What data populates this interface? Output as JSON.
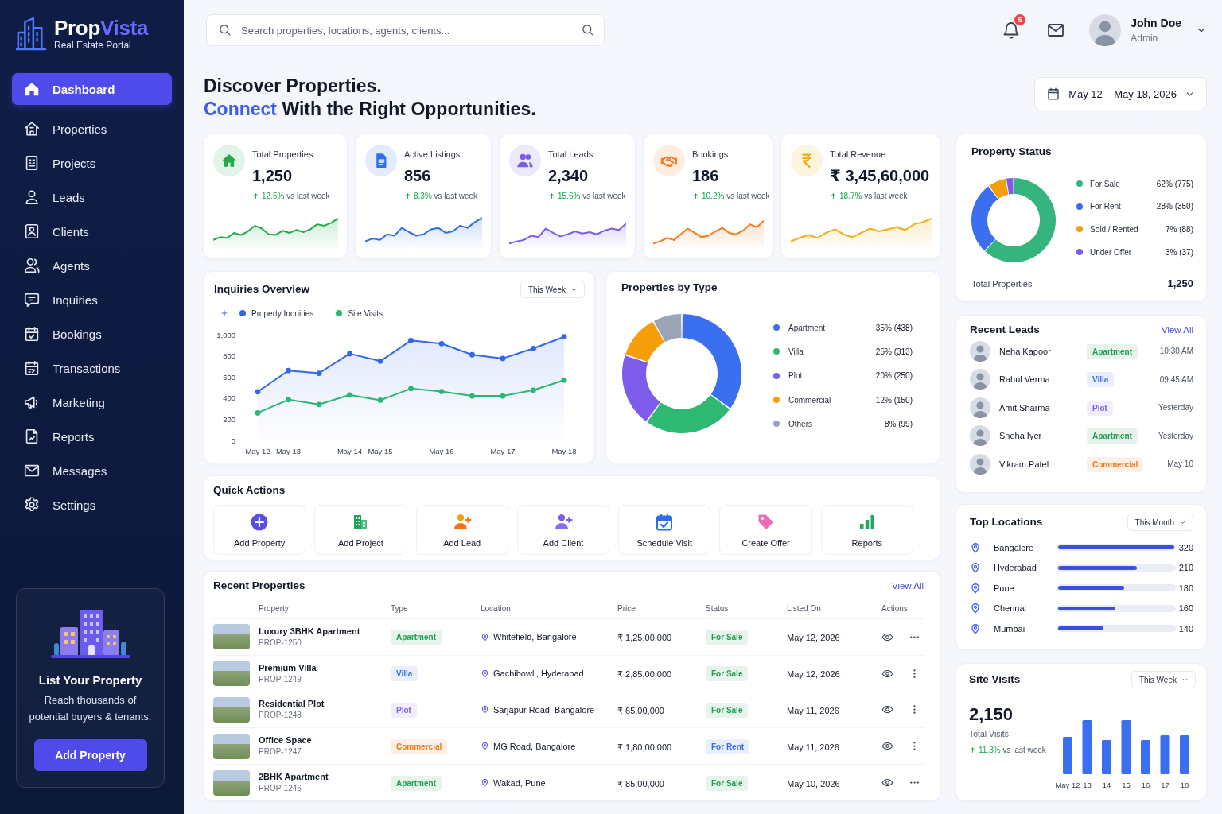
{
  "sidebar": {
    "brand": {
      "name": "Prop",
      "name_accent": "Vista",
      "tagline": "Real Estate Portal"
    },
    "nav": [
      {
        "label": "Dashboard",
        "selected": true
      },
      {
        "label": "Properties",
        "selected": false
      },
      {
        "label": "Projects",
        "selected": false
      },
      {
        "label": "Leads",
        "selected": false
      },
      {
        "label": "Clients",
        "selected": false
      },
      {
        "label": "Agents",
        "selected": false
      },
      {
        "label": "Inquiries",
        "selected": false
      },
      {
        "label": "Bookings",
        "selected": false
      },
      {
        "label": "Transactions",
        "selected": false
      },
      {
        "label": "Marketing",
        "selected": false
      },
      {
        "label": "Reports",
        "selected": false
      },
      {
        "label": "Messages",
        "selected": false
      },
      {
        "label": "Settings",
        "selected": false
      }
    ],
    "promo": {
      "title": "List Your Property",
      "text": "Reach thousands of potential buyers & tenants.",
      "button": "Add Property"
    }
  },
  "header": {
    "search": {
      "placeholder": "Search properties, locations, agents, clients..."
    },
    "notifications": {
      "count": "5"
    },
    "user": {
      "name": "John Doe",
      "role": "Admin"
    }
  },
  "intro": {
    "title": "Discover Properties.",
    "highlight": "Connect",
    "subtitle": "With the Right Opportunities."
  },
  "date_range": {
    "label": "May 12 – May 18, 2026"
  },
  "stats": [
    {
      "label": "Total Properties",
      "value": "1,250",
      "change": "12.5%",
      "change_note": "vs last week",
      "color": "#23a94b"
    },
    {
      "label": "Active Listings",
      "value": "856",
      "change": "8.3%",
      "change_note": "vs last week",
      "color": "#2f6fe6"
    },
    {
      "label": "Total Leads",
      "value": "2,340",
      "change": "15.6%",
      "change_note": "vs last week",
      "color": "#7b5ce8"
    },
    {
      "label": "Bookings",
      "value": "186",
      "change": "10.2%",
      "change_note": "vs last week",
      "color": "#f47a1f"
    },
    {
      "label": "Total Revenue",
      "value": "₹ 3,45,60,000",
      "change": "18.7%",
      "change_note": "vs last week",
      "color": "#f2ad17"
    }
  ],
  "inquiries": {
    "title": "Inquiries Overview",
    "period": "This Week",
    "chart_data": {
      "type": "line",
      "legend": "top",
      "categories": [
        "May 12",
        "May 13",
        null,
        "May 14",
        "May 15",
        null,
        "May 16",
        null,
        "May 17",
        null,
        "May 18"
      ],
      "ylim": [
        0,
        1000
      ],
      "yticks": [
        0,
        200,
        400,
        600,
        800,
        {
          "value": 1000,
          "label": "1,000"
        }
      ],
      "series": [
        {
          "name": "Property Inquiries",
          "type": "area",
          "marker": "circle",
          "color": "#3366ee",
          "values": [
            460,
            660,
            635,
            820,
            750,
            945,
            915,
            810,
            775,
            870,
            980
          ]
        },
        {
          "name": "Site Visits",
          "type": "line",
          "marker": "circle",
          "color": "#2bb673",
          "values": [
            260,
            385,
            340,
            430,
            380,
            490,
            462,
            420,
            420,
            475,
            570
          ]
        }
      ]
    }
  },
  "property_types": {
    "title": "Properties by Type",
    "chart_data": {
      "type": "donut",
      "legend": "right",
      "categories": [
        "Apartment",
        "Villa",
        "Plot",
        "Commercial",
        "Others"
      ],
      "values": [
        438,
        313,
        250,
        150,
        99
      ],
      "value_labels": [
        "35% (438)",
        "25% (313)",
        "20% (250)",
        "12% (150)",
        "8% (99)"
      ],
      "colors": [
        "#3a6ff0",
        "#2eb872",
        "#7c5ce8",
        "#f59e0b",
        "#9aa5b8"
      ]
    }
  },
  "quick_actions": {
    "title": "Quick Actions",
    "items": [
      "Add Property",
      "Add Project",
      "Add Lead",
      "Add Client",
      "Schedule Visit",
      "Create Offer",
      "Reports"
    ]
  },
  "recent_properties": {
    "title": "Recent Properties",
    "link": "View All",
    "columns": [
      "Property",
      "Type",
      "Location",
      "Price",
      "Status",
      "Listed On",
      "Actions"
    ],
    "rows": [
      {
        "name": "Luxury 3BHK Apartment",
        "id": "PROP-1250",
        "type": {
          "label": "Apartment",
          "color": "#1e9e52"
        },
        "location": "Whitefield, Bangalore",
        "price": "₹ 1,25,00,000",
        "status": {
          "label": "For Sale",
          "color": "#1e9e52"
        },
        "listed_on": "May 12, 2026"
      },
      {
        "name": "Premium Villa",
        "id": "PROP-1249",
        "type": {
          "label": "Villa",
          "color": "#3b6fe0"
        },
        "location": "Gachibowli, Hyderabad",
        "price": "₹ 2,85,00,000",
        "status": {
          "label": "For Sale",
          "color": "#1e9e52"
        },
        "listed_on": "May 12, 2026"
      },
      {
        "name": "Residential Plot",
        "id": "PROP-1248",
        "type": {
          "label": "Plot",
          "color": "#7c5ce6"
        },
        "location": "Sarjapur Road, Bangalore",
        "price": "₹ 65,00,000",
        "status": {
          "label": "For Sale",
          "color": "#1e9e52"
        },
        "listed_on": "May 11, 2026"
      },
      {
        "name": "Office Space",
        "id": "PROP-1247",
        "type": {
          "label": "Commercial",
          "color": "#f07a1a"
        },
        "location": "MG Road, Bangalore",
        "price": "₹ 1,80,00,000",
        "status": {
          "label": "For Rent",
          "color": "#3b6fe0"
        },
        "listed_on": "May 11, 2026"
      },
      {
        "name": "2BHK Apartment",
        "id": "PROP-1246",
        "type": {
          "label": "Apartment",
          "color": "#1e9e52"
        },
        "location": "Wakad, Pune",
        "price": "₹ 85,00,000",
        "status": {
          "label": "For Sale",
          "color": "#1e9e52"
        },
        "listed_on": "May 10, 2026"
      }
    ]
  },
  "property_status": {
    "title": "Property Status",
    "chart_data": {
      "type": "donut",
      "legend": "right",
      "categories": [
        "For Sale",
        "For Rent",
        "Sold / Rented",
        "Under Offer"
      ],
      "values": [
        775,
        350,
        88,
        37
      ],
      "value_labels": [
        "62% (775)",
        "28% (350)",
        "7% (88)",
        "3% (37)"
      ],
      "colors": [
        "#35b57d",
        "#3b6ff0",
        "#f5a00b",
        "#7c5ce8"
      ]
    },
    "total_label": "Total Properties",
    "total_value": "1,250"
  },
  "recent_leads": {
    "title": "Recent Leads",
    "link": "View All",
    "items": [
      {
        "name": "Neha Kapoor",
        "tag": {
          "label": "Apartment",
          "color": "#1e9e52"
        },
        "time": "10:30 AM"
      },
      {
        "name": "Rahul Verma",
        "tag": {
          "label": "Villa",
          "color": "#3b6fe0"
        },
        "time": "09:45 AM"
      },
      {
        "name": "Amit Sharma",
        "tag": {
          "label": "Plot",
          "color": "#7c5ce6"
        },
        "time": "Yesterday"
      },
      {
        "name": "Sneha Iyer",
        "tag": {
          "label": "Apartment",
          "color": "#1e9e52"
        },
        "time": "Yesterday"
      },
      {
        "name": "Vikram Patel",
        "tag": {
          "label": "Commercial",
          "color": "#f07a1a"
        },
        "time": "May 10"
      }
    ]
  },
  "top_locations": {
    "title": "Top Locations",
    "period": "This Month",
    "items": [
      {
        "city": "Bangalore",
        "level": 1.0,
        "count": "320"
      },
      {
        "city": "Hyderabad",
        "level": 0.68,
        "count": "210"
      },
      {
        "city": "Pune",
        "level": 0.57,
        "count": "180"
      },
      {
        "city": "Chennai",
        "level": 0.49,
        "count": "160"
      },
      {
        "city": "Mumbai",
        "level": 0.39,
        "count": "140"
      }
    ]
  },
  "site_visits": {
    "title": "Site Visits",
    "period": "This Week",
    "value": "2,150",
    "label": "Total Visits",
    "change": "11.3%",
    "change_note": "vs last week",
    "days": [
      "May 12",
      "13",
      "14",
      "15",
      "16",
      "17",
      "18"
    ]
  }
}
